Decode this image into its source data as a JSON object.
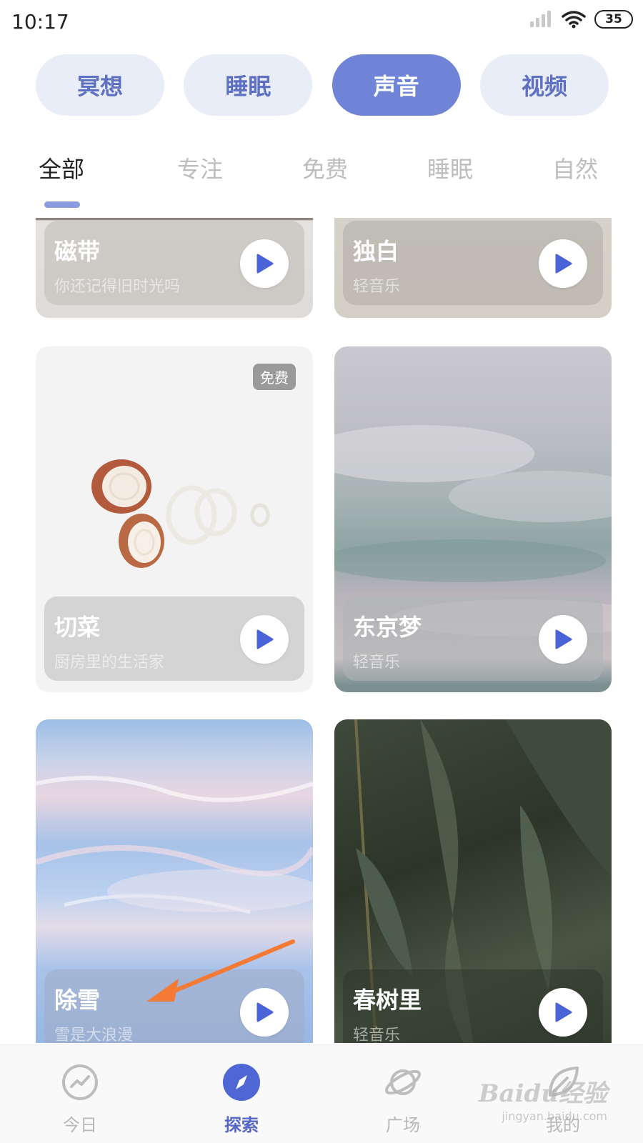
{
  "status_bar": {
    "time": "10:17",
    "battery": "35"
  },
  "category_pills": [
    {
      "label": "冥想",
      "active": false
    },
    {
      "label": "睡眠",
      "active": false
    },
    {
      "label": "声音",
      "active": true
    },
    {
      "label": "视频",
      "active": false
    }
  ],
  "sub_tabs": [
    "全部",
    "专注",
    "免费",
    "睡眠",
    "自然"
  ],
  "active_sub_tab": "全部",
  "cards": [
    {
      "title": "磁带",
      "subtitle": "你还记得旧时光吗"
    },
    {
      "title": "独白",
      "subtitle": "轻音乐"
    },
    {
      "title": "切菜",
      "subtitle": "厨房里的生活家",
      "badge": "免费"
    },
    {
      "title": "东京梦",
      "subtitle": "轻音乐"
    },
    {
      "title": "除雪",
      "subtitle": "雪是大浪漫"
    },
    {
      "title": "春树里",
      "subtitle": "轻音乐"
    }
  ],
  "bottom_nav": [
    {
      "label": "今日",
      "icon": "chart-icon",
      "active": false
    },
    {
      "label": "探索",
      "icon": "compass-icon",
      "active": true
    },
    {
      "label": "广场",
      "icon": "planet-icon",
      "active": false
    },
    {
      "label": "我的",
      "icon": "leaf-icon",
      "active": false
    }
  ],
  "watermark": {
    "text": "Baidu经验",
    "url": "jingyan.baidu.com"
  },
  "colors": {
    "accent": "#6f84d6",
    "pill_bg": "#e9edf8",
    "pill_text": "#5e70c2",
    "nav_active": "#5567c9",
    "annotation_arrow": "#f47a35"
  }
}
